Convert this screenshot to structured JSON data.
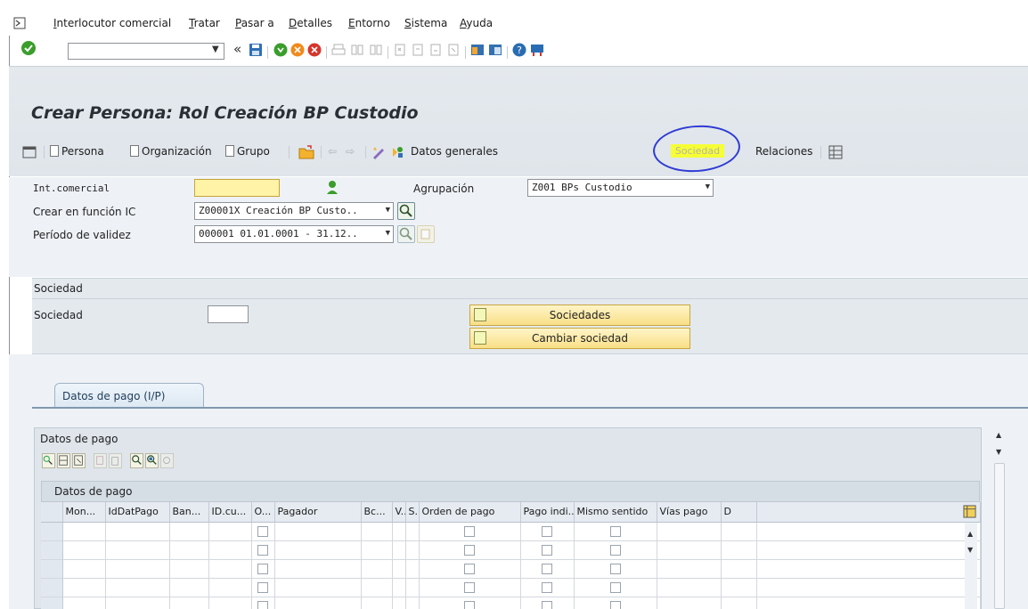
{
  "menu": {
    "items": [
      "Interlocutor comercial",
      "Tratar",
      "Pasar a",
      "Detalles",
      "Entorno",
      "Sistema",
      "Ayuda"
    ]
  },
  "toolbar": {
    "back_label": "«"
  },
  "title": "Crear Persona: Rol Creación BP Custodio",
  "app_toolbar": {
    "persona": "Persona",
    "organizacion": "Organización",
    "grupo": "Grupo",
    "datos_generales": "Datos generales",
    "sociedad": "Sociedad",
    "relaciones": "Relaciones"
  },
  "form": {
    "int_comercial_label": "Int.comercial",
    "int_comercial_value": "",
    "agrupacion_label": "Agrupación",
    "agrupacion_value": "Z001 BPs Custodio",
    "crear_funcion_label": "Crear en función IC",
    "crear_funcion_value": "Z00001X Creación BP Custo..",
    "periodo_label": "Período de validez",
    "periodo_value": "000001 01.01.0001 - 31.12.."
  },
  "sociedad_group": {
    "title": "Sociedad",
    "sociedad_label": "Sociedad",
    "sociedad_value": "",
    "btn_sociedades": "Sociedades",
    "btn_cambiar": "Cambiar sociedad"
  },
  "tabs": {
    "active": "Datos de pago (I/P)"
  },
  "pago_group": {
    "title": "Datos de pago",
    "table_title": "Datos de pago",
    "columns": [
      "Mon...",
      "IdDatPago",
      "Ban...",
      "ID.cu...",
      "O...",
      "Pagador",
      "Bc...",
      "V..",
      "S..",
      "Orden de pago",
      "Pago indi...",
      "Mismo sentido",
      "Vías pago",
      "D"
    ]
  },
  "colors": {
    "highlight_fill": "#f6ff35",
    "annotation_ring": "#2f3ad4",
    "title_bar": "#e4e9ee"
  }
}
